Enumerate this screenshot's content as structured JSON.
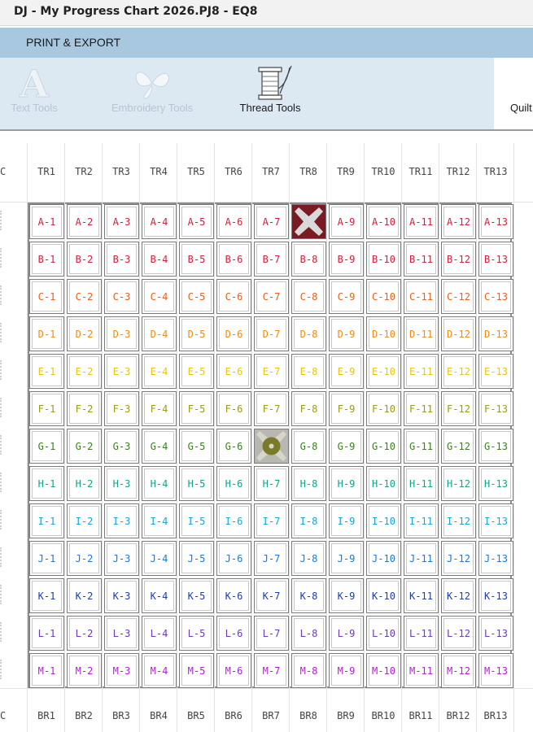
{
  "window": {
    "title": "DJ - My Progress Chart 2026.PJ8 - EQ8"
  },
  "tab": {
    "label": "PRINT & EXPORT"
  },
  "ribbon": {
    "text_tools": "Text Tools",
    "embroidery_tools": "Embroidery Tools",
    "thread_tools": "Thread Tools",
    "quilt_partial": "Quilt"
  },
  "edge_label": "C",
  "top_headers": [
    "TR1",
    "TR2",
    "TR3",
    "TR4",
    "TR5",
    "TR6",
    "TR7",
    "TR8",
    "TR9",
    "TR10",
    "TR11",
    "TR12",
    "TR13"
  ],
  "bottom_headers": [
    "BR1",
    "BR2",
    "BR3",
    "BR4",
    "BR5",
    "BR6",
    "BR7",
    "BR8",
    "BR9",
    "BR10",
    "BR11",
    "BR12",
    "BR13"
  ],
  "rows": [
    {
      "letter": "A",
      "color": "#d2203a",
      "cells": [
        "A-1",
        "A-2",
        "A-3",
        "A-4",
        "A-5",
        "A-6",
        "A-7",
        "",
        "A-9",
        "A-10",
        "A-11",
        "A-12",
        "A-13"
      ]
    },
    {
      "letter": "B",
      "color": "#d2203a",
      "cells": [
        "B-1",
        "B-2",
        "B-3",
        "B-4",
        "B-5",
        "B-6",
        "B-7",
        "B-8",
        "B-9",
        "B-10",
        "B-11",
        "B-12",
        "B-13"
      ]
    },
    {
      "letter": "C",
      "color": "#e8601c",
      "cells": [
        "C-1",
        "C-2",
        "C-3",
        "C-4",
        "C-5",
        "C-6",
        "C-7",
        "C-8",
        "C-9",
        "C-10",
        "C-11",
        "C-12",
        "C-13"
      ]
    },
    {
      "letter": "D",
      "color": "#ec8a1a",
      "cells": [
        "D-1",
        "D-2",
        "D-3",
        "D-4",
        "D-5",
        "D-6",
        "D-7",
        "D-8",
        "D-9",
        "D-10",
        "D-11",
        "D-12",
        "D-13"
      ]
    },
    {
      "letter": "E",
      "color": "#e6c51a",
      "cells": [
        "E-1",
        "E-2",
        "E-3",
        "E-4",
        "E-5",
        "E-6",
        "E-7",
        "E-8",
        "E-9",
        "E-10",
        "E-11",
        "E-12",
        "E-13"
      ]
    },
    {
      "letter": "F",
      "color": "#9a9a18",
      "cells": [
        "F-1",
        "F-2",
        "F-3",
        "F-4",
        "F-5",
        "F-6",
        "F-7",
        "F-8",
        "F-9",
        "F-10",
        "F-11",
        "F-12",
        "F-13"
      ]
    },
    {
      "letter": "G",
      "color": "#3d7d22",
      "cells": [
        "G-1",
        "G-2",
        "G-3",
        "G-4",
        "G-5",
        "G-6",
        "",
        "G-8",
        "G-9",
        "G-10",
        "G-11",
        "G-12",
        "G-13"
      ]
    },
    {
      "letter": "H",
      "color": "#14a28c",
      "cells": [
        "H-1",
        "H-2",
        "H-3",
        "H-4",
        "H-5",
        "H-6",
        "H-7",
        "H-8",
        "H-9",
        "H-10",
        "H-11",
        "H-12",
        "H-13"
      ]
    },
    {
      "letter": "I",
      "color": "#1aa3d8",
      "cells": [
        "I-1",
        "I-2",
        "I-3",
        "I-4",
        "I-5",
        "I-6",
        "I-7",
        "I-8",
        "I-9",
        "I-10",
        "I-11",
        "I-12",
        "I-13"
      ]
    },
    {
      "letter": "J",
      "color": "#1c78d8",
      "cells": [
        "J-1",
        "J-2",
        "J-3",
        "J-4",
        "J-5",
        "J-6",
        "J-7",
        "J-8",
        "J-9",
        "J-10",
        "J-11",
        "J-12",
        "J-13"
      ]
    },
    {
      "letter": "K",
      "color": "#1e3ea8",
      "cells": [
        "K-1",
        "K-2",
        "K-3",
        "K-4",
        "K-5",
        "K-6",
        "K-7",
        "K-8",
        "K-9",
        "K-10",
        "K-11",
        "K-12",
        "K-13"
      ]
    },
    {
      "letter": "L",
      "color": "#6a3ab8",
      "cells": [
        "L-1",
        "L-2",
        "L-3",
        "L-4",
        "L-5",
        "L-6",
        "L-7",
        "L-8",
        "L-9",
        "L-10",
        "L-11",
        "L-12",
        "L-13"
      ]
    },
    {
      "letter": "M",
      "color": "#b21ed2",
      "cells": [
        "M-1",
        "M-2",
        "M-3",
        "M-4",
        "M-5",
        "M-6",
        "M-7",
        "M-8",
        "M-9",
        "M-10",
        "M-11",
        "M-12",
        "M-13"
      ]
    }
  ],
  "placed_blocks": [
    {
      "row": 0,
      "col": 7,
      "icon": "maroon-cross-block",
      "colors": [
        "#7a1a22",
        "#d9d9d9"
      ]
    },
    {
      "row": 6,
      "col": 6,
      "icon": "olive-cross-block",
      "colors": [
        "#b8b8b0",
        "#7a7a28"
      ]
    }
  ]
}
